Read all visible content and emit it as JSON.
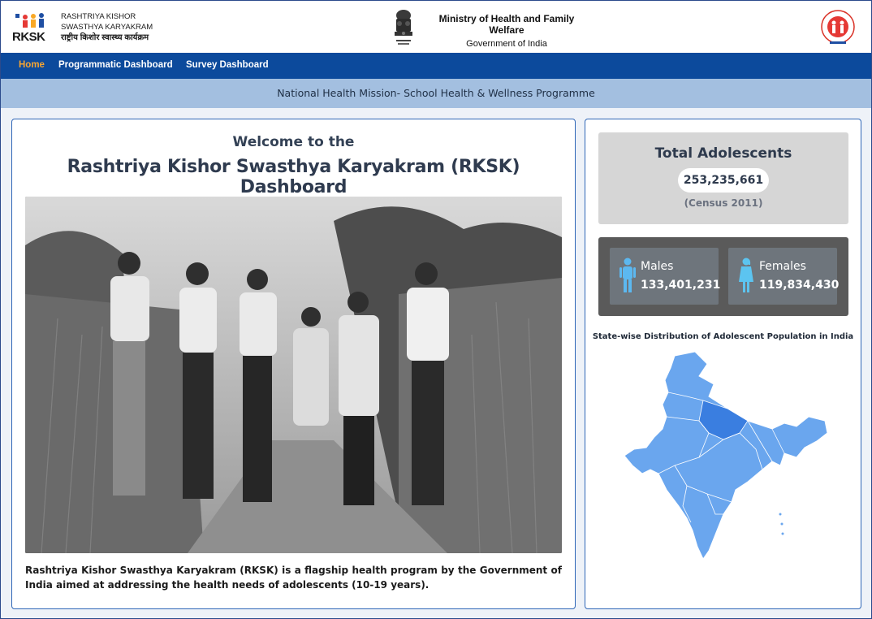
{
  "header": {
    "rksk_logo_text": "RKSK",
    "program_name_line1": "RASHTRIYA KISHOR",
    "program_name_line2": "SWASTHYA KARYAKRAM",
    "program_name_hindi": "राष्ट्रीय किशोर स्वास्थ्य कार्यक्रम",
    "ministry": "Ministry of Health and Family Welfare",
    "government": "Government of India",
    "nhm_logo": "national-health-mission-logo"
  },
  "nav": {
    "items": [
      {
        "label": "Home",
        "active": true
      },
      {
        "label": "Programmatic Dashboard",
        "active": false
      },
      {
        "label": "Survey Dashboard",
        "active": false
      }
    ]
  },
  "banner": {
    "text": "National Health Mission- School Health & Wellness Programme"
  },
  "main": {
    "welcome": "Welcome to the",
    "title": "Rashtriya Kishor Swasthya Karyakram (RKSK) Dashboard",
    "intro": "Rashtriya Kishor Swasthya Karyakram (RKSK) is a flagship health program by the Government of India aimed at addressing the health needs of adolescents (10-19 years)."
  },
  "stats": {
    "total_title": "Total Adolescents",
    "total_value": "253,235,661",
    "census_note": "(Census 2011)",
    "males_label": "Males",
    "males_value": "133,401,231",
    "females_label": "Females",
    "females_value": "119,834,430"
  },
  "map": {
    "title": "State-wise Distribution of Adolescent Population in India"
  },
  "colors": {
    "nav_bg": "#0c4a9c",
    "nav_active": "#f7a531",
    "banner_bg": "#a3bfe0",
    "map_fill": "#6aa6ee",
    "map_highlight": "#3a7ee0",
    "male_icon": "#5cb8f0",
    "female_icon": "#5cc4f0"
  }
}
